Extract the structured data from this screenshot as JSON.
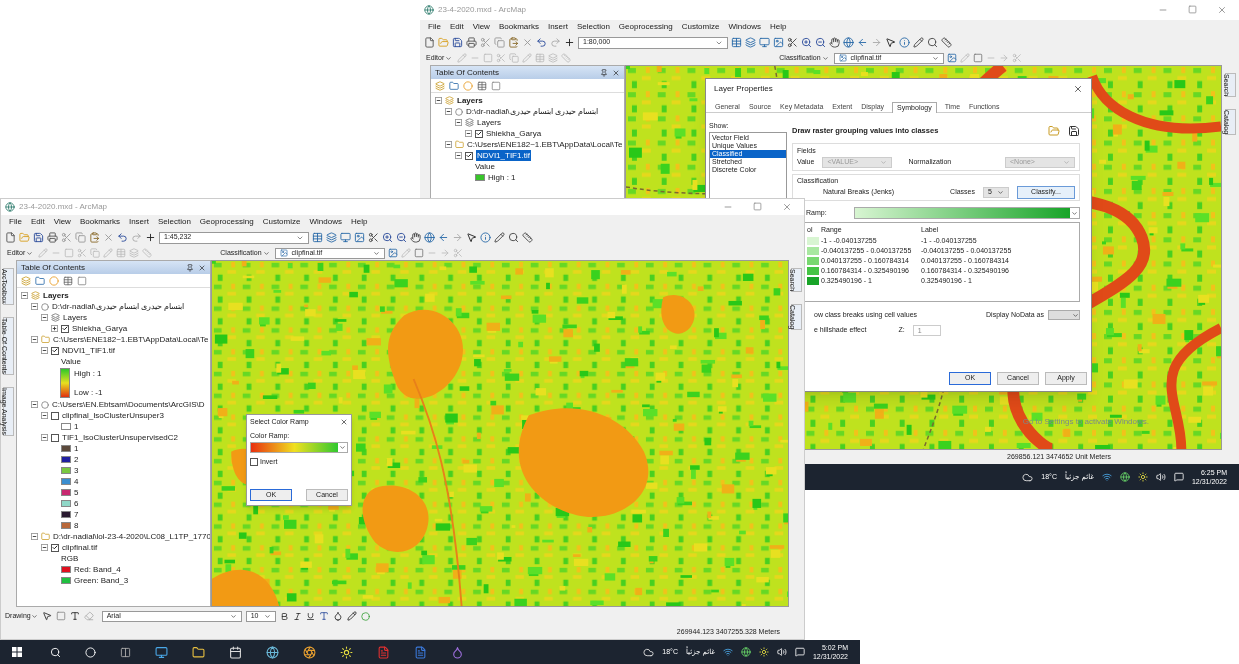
{
  "back_window": {
    "title": "23-4-2020.mxd - ArcMap",
    "menu": [
      "File",
      "Edit",
      "View",
      "Bookmarks",
      "Insert",
      "Selection",
      "Geoprocessing",
      "Customize",
      "Windows",
      "Help"
    ],
    "scale": "1:80,000",
    "editor_label": "Editor",
    "classification_label": "Classification",
    "classification_layer": "clipfinal.tif",
    "side_tabs": [
      "Search",
      "Catalog"
    ],
    "toc": {
      "title": "Table Of Contents",
      "tree": [
        {
          "kind": "frame",
          "label": "Layers",
          "expanded": true,
          "children": [
            {
              "kind": "group",
              "label": "D:\\dr-nadial\\ابتسام حیدری ابتسام حیدری",
              "expanded": true,
              "children": [
                {
                  "kind": "sublayers",
                  "label": "Layers",
                  "expanded": true,
                  "children": [
                    {
                      "kind": "layer",
                      "label": "Shiekha_Garya",
                      "checked": true,
                      "expanded": true,
                      "selected": false
                    }
                  ]
                }
              ]
            },
            {
              "kind": "workspace",
              "label": "C:\\Users\\ENE182~1.EBT\\AppData\\Local\\Te",
              "expanded": true,
              "children": [
                {
                  "kind": "layer",
                  "label": "NDVI1_TIF1.tif",
                  "checked": true,
                  "expanded": true,
                  "selected": true,
                  "children": [
                    {
                      "kind": "text",
                      "label": "Value"
                    },
                    {
                      "kind": "swatch",
                      "label": "High : 1",
                      "color": "#38c42a"
                    }
                  ]
                }
              ]
            }
          ]
        }
      ]
    },
    "dialog": {
      "title": "Layer Properties",
      "tabs": [
        {
          "label": "General",
          "selected": false
        },
        {
          "label": "Source",
          "selected": false
        },
        {
          "label": "Key Metadata",
          "selected": false
        },
        {
          "label": "Extent",
          "selected": false
        },
        {
          "label": "Display",
          "selected": false
        },
        {
          "label": "Symbology",
          "selected": true
        },
        {
          "label": "Time",
          "selected": false
        },
        {
          "label": "Functions",
          "selected": false
        }
      ],
      "show_label": "Show:",
      "show_items": [
        {
          "label": "Vector Field",
          "selected": false
        },
        {
          "label": "Unique Values",
          "selected": false
        },
        {
          "label": "Classified",
          "selected": true
        },
        {
          "label": "Stretched",
          "selected": false
        },
        {
          "label": "Discrete Color",
          "selected": false
        }
      ],
      "heading": "Draw raster grouping values into classes",
      "fields_label": "Fields",
      "value_label": "Value",
      "value_field": "<VALUE>",
      "normalization_label": "Normalization",
      "normalization_field": "<None>",
      "classification_label": "Classification",
      "method": "Natural Breaks (Jenks)",
      "classes_label": "Classes",
      "classes_value": "5",
      "classify_button": "Classify...",
      "ramp_label": "Ramp:",
      "columns": [
        "ol",
        "Range",
        "Label"
      ],
      "rows": [
        {
          "range": "-1 - -0.040137255",
          "label": "-1 - -0.040137255",
          "color": "#d8f5d2"
        },
        {
          "range": "-0.040137255 - 0.040137255",
          "label": "-0.040137255 - 0.040137255",
          "color": "#a8e8a0"
        },
        {
          "range": "0.040137255 - 0.160784314",
          "label": "0.040137255 - 0.160784314",
          "color": "#78d870"
        },
        {
          "range": "0.160784314 - 0.325490196",
          "label": "0.160784314 - 0.325490196",
          "color": "#44c444"
        },
        {
          "range": "0.325490196 - 1",
          "label": "0.325490196 - 1",
          "color": "#18a428"
        }
      ],
      "breaks_label": "ow class breaks using cell values",
      "nodata_label": "Display NoData as",
      "hillshade_label": "e hillshade effect",
      "z_label": "Z:",
      "z_value": "1",
      "buttons": [
        "OK",
        "Cancel",
        "Apply"
      ]
    },
    "activation": "Go to Settings to activate Windows.",
    "coordinates": "269856.121 3474652 Unit Meters",
    "taskbar": {
      "temperature": "18°C",
      "weather": "غائم جزئياً",
      "time": "6:25 PM",
      "date": "12/31/2022"
    }
  },
  "front_window": {
    "title": "23-4-2020.mxd - ArcMap",
    "menu": [
      "File",
      "Edit",
      "View",
      "Bookmarks",
      "Insert",
      "Selection",
      "Geoprocessing",
      "Customize",
      "Windows",
      "Help"
    ],
    "scale": "1:45,232",
    "editor_label": "Editor",
    "classification_label": "Classification",
    "classification_layer": "clipfinal.tif",
    "left_tabs": [
      "ArcToolbox",
      "Table Of Contents",
      "Image Analysis"
    ],
    "side_tabs": [
      "Search",
      "Catalog"
    ],
    "toc": {
      "title": "Table Of Contents",
      "tree": [
        {
          "kind": "frame",
          "label": "Layers",
          "expanded": true,
          "children": [
            {
              "kind": "group",
              "label": "D:\\dr-nadial\\ابتسام حیدری ابتسام حیدری",
              "expanded": true,
              "children": [
                {
                  "kind": "sublayers",
                  "label": "Layers",
                  "expanded": true,
                  "children": [
                    {
                      "kind": "layer",
                      "label": "Shiekha_Garya",
                      "checked": true,
                      "expanded": false,
                      "selected": false
                    }
                  ]
                }
              ]
            },
            {
              "kind": "workspace",
              "label": "C:\\Users\\ENE182~1.EBT\\AppData\\Local\\Te",
              "expanded": true,
              "children": [
                {
                  "kind": "layer",
                  "label": "NDVI1_TIF1.tif",
                  "checked": true,
                  "expanded": true,
                  "selected": false,
                  "children": [
                    {
                      "kind": "text",
                      "label": "Value"
                    },
                    {
                      "kind": "ramp",
                      "high": "High : 1",
                      "low": "Low : -1"
                    }
                  ]
                }
              ]
            },
            {
              "kind": "group",
              "label": "C:\\Users\\EN.Ebtsam\\Documents\\ArcGIS\\D",
              "expanded": true,
              "children": [
                {
                  "kind": "layer",
                  "label": "clipfinal_IsoClusterUnsuper3",
                  "checked": false,
                  "expanded": true,
                  "selected": false,
                  "children": [
                    {
                      "kind": "swatch",
                      "label": "1",
                      "color": "#ffffff"
                    }
                  ]
                },
                {
                  "kind": "layer",
                  "label": "TIF1_IsoClusterUnsupervisedC2",
                  "checked": false,
                  "expanded": true,
                  "selected": false,
                  "children": [
                    {
                      "kind": "swatch",
                      "label": "1",
                      "color": "#5c4a3c"
                    },
                    {
                      "kind": "swatch",
                      "label": "2",
                      "color": "#2020a0"
                    },
                    {
                      "kind": "swatch",
                      "label": "3",
                      "color": "#78c840"
                    },
                    {
                      "kind": "swatch",
                      "label": "4",
                      "color": "#3a8ed0"
                    },
                    {
                      "kind": "swatch",
                      "label": "5",
                      "color": "#c82870"
                    },
                    {
                      "kind": "swatch",
                      "label": "6",
                      "color": "#90d8c8"
                    },
                    {
                      "kind": "swatch",
                      "label": "7",
                      "color": "#2a1a30"
                    },
                    {
                      "kind": "swatch",
                      "label": "8",
                      "color": "#b8683a"
                    }
                  ]
                }
              ]
            },
            {
              "kind": "workspace",
              "label": "D:\\dr-nadial\\lol-23-4-2020\\LC08_L1TP_1770",
              "expanded": true,
              "children": [
                {
                  "kind": "layer",
                  "label": "clipfinal.tif",
                  "checked": true,
                  "expanded": true,
                  "selected": false,
                  "children": [
                    {
                      "kind": "text",
                      "label": "RGB"
                    },
                    {
                      "kind": "swatch",
                      "label": "Red:   Band_4",
                      "color": "#e01020"
                    },
                    {
                      "kind": "swatch",
                      "label": "Green: Band_3",
                      "color": "#20c040"
                    }
                  ]
                }
              ]
            }
          ]
        }
      ]
    },
    "color_ramp_dialog": {
      "title": "Select Color Ramp",
      "ramp_label": "Color Ramp:",
      "invert": {
        "label": "Invert",
        "checked": false
      },
      "buttons": [
        "OK",
        "Cancel"
      ]
    },
    "drawing_label": "Drawing",
    "font": "Arial",
    "font_size": "10",
    "coordinates": "269944.123 3407255.328 Meters",
    "taskbar": {
      "temperature": "18°C",
      "weather": "غائم جزئياً",
      "time": "5:02 PM",
      "date": "12/31/2022"
    }
  }
}
